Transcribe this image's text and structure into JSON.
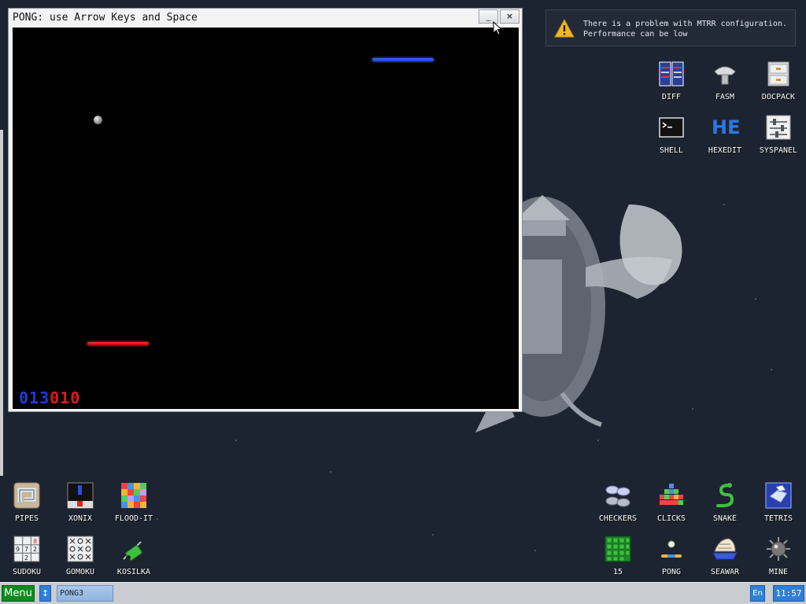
{
  "window": {
    "title": "PONG: use Arrow Keys and Space",
    "minimize_label": "_",
    "close_label": "×"
  },
  "game": {
    "score_blue": "013",
    "score_red": "010",
    "colors": {
      "blue": "#1f3bd8",
      "red": "#dd1a1a",
      "field": "#000000"
    }
  },
  "notification": {
    "icon": "warning-icon",
    "line1": "There is a problem with MTRR configuration.",
    "line2": "Performance can be low"
  },
  "desktop_icons_right": [
    {
      "label": "DIFF",
      "icon": "diff-icon"
    },
    {
      "label": "FASM",
      "icon": "fasm-icon"
    },
    {
      "label": "DOCPACK",
      "icon": "docpack-icon"
    },
    {
      "label": "SHELL",
      "icon": "shell-icon"
    },
    {
      "label": "HEXEDIT",
      "icon": "hexedit-icon",
      "glyph": "HE"
    },
    {
      "label": "SYSPANEL",
      "icon": "syspanel-icon"
    }
  ],
  "desktop_icons_bottom_left": [
    {
      "label": "PIPES",
      "icon": "pipes-icon"
    },
    {
      "label": "XONIX",
      "icon": "xonix-icon"
    },
    {
      "label": "FLOOD-IT",
      "icon": "flood-it-icon"
    },
    {
      "label": "SUDOKU",
      "icon": "sudoku-icon"
    },
    {
      "label": "GOMOKU",
      "icon": "gomoku-icon"
    },
    {
      "label": "KOSILKA",
      "icon": "kosilka-icon"
    }
  ],
  "desktop_icons_bottom_right": [
    {
      "label": "CHECKERS",
      "icon": "checkers-icon"
    },
    {
      "label": "CLICKS",
      "icon": "clicks-icon"
    },
    {
      "label": "SNAKE",
      "icon": "snake-icon"
    },
    {
      "label": "TETRIS",
      "icon": "tetris-icon"
    },
    {
      "label": "15",
      "icon": "fifteen-icon"
    },
    {
      "label": "PONG",
      "icon": "pong-icon"
    },
    {
      "label": "SEAWAR",
      "icon": "seawar-icon"
    },
    {
      "label": "MINE",
      "icon": "mine-icon"
    }
  ],
  "taskbar": {
    "menu_label": "Menu",
    "swap_label": "↕",
    "task_label": "PONG3",
    "lang_label": "En",
    "clock": "11:57"
  }
}
